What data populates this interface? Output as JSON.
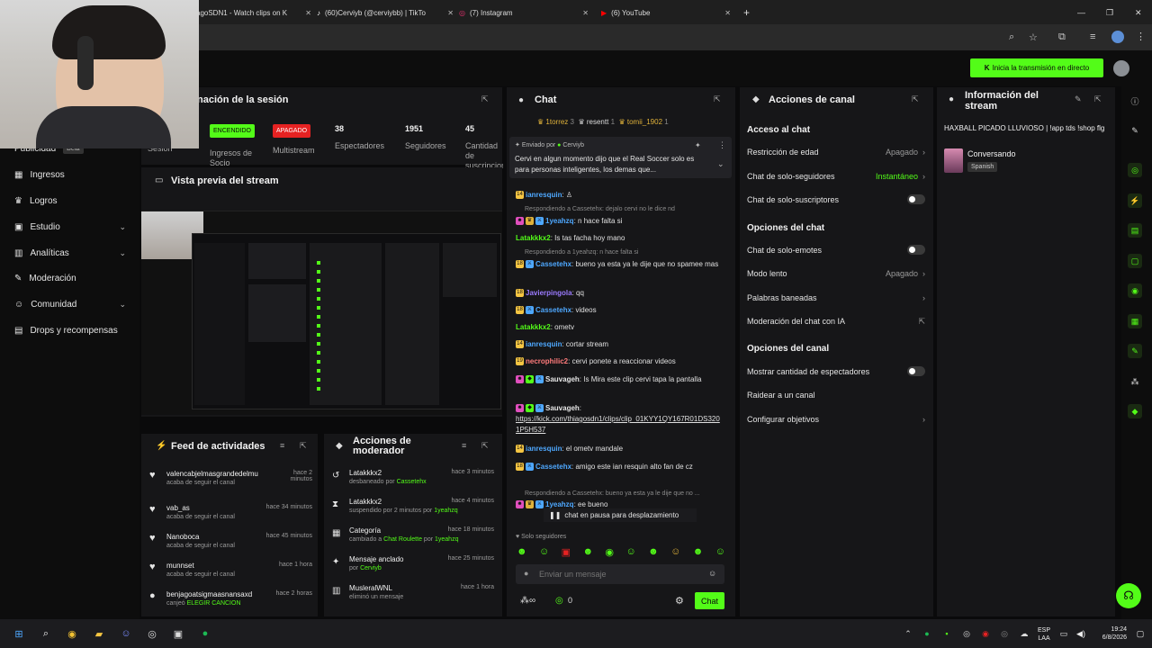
{
  "browser": {
    "tabs": [
      {
        "label": "agoSDN1 - Watch clips on K",
        "icon": "kick-icon"
      },
      {
        "label": "(60)Cerviyb (@cerviybb) | TikTo",
        "icon": "tiktok-icon"
      },
      {
        "label": "(7) Instagram",
        "icon": "instagram-icon"
      },
      {
        "label": "(6) YouTube",
        "icon": "youtube-icon"
      }
    ],
    "new_tab": "+",
    "window_controls": [
      "—",
      "❐",
      "✕"
    ]
  },
  "header": {
    "go_live_label": "Inicia la transmisión en directo"
  },
  "nav": {
    "items": [
      {
        "label": "Publicidad",
        "badge": "Beta"
      },
      {
        "label": "Ingresos"
      },
      {
        "label": "Logros"
      },
      {
        "label": "Estudio",
        "expand": true
      },
      {
        "label": "Analíticas",
        "expand": true
      },
      {
        "label": "Moderación"
      },
      {
        "label": "Comunidad",
        "expand": true
      },
      {
        "label": "Drops y recompensas"
      }
    ]
  },
  "session": {
    "title": "nación de la sesión",
    "stats": [
      {
        "label_bottom": "Sesión"
      },
      {
        "value": "ENCENDIDO",
        "label": "Ingresos de Socio",
        "color": "#53fc18"
      },
      {
        "value": "APAGADO",
        "label": "Multistream",
        "color": "#e62222"
      },
      {
        "value": "38",
        "label": "Espectadores"
      },
      {
        "value": "1951",
        "label": "Seguidores"
      },
      {
        "value": "45",
        "label": "Cantidad de suscripcion"
      }
    ]
  },
  "preview": {
    "title": "Vista previa del stream"
  },
  "feed": {
    "title": "Feed de actividades",
    "rows": [
      {
        "name": "valencabjelmasgrandedelmu",
        "sub": "acaba de seguir el canal",
        "time": "hace 2 minutos"
      },
      {
        "name": "vab_as",
        "sub": "acaba de seguir el canal",
        "time": "hace 34 minutos"
      },
      {
        "name": "Nanoboca",
        "sub": "acaba de seguir el canal",
        "time": "hace 45 minutos"
      },
      {
        "name": "munnset",
        "sub": "acaba de seguir el canal",
        "time": "hace 1 hora"
      },
      {
        "name": "benjagoatsigmaasnansaxd",
        "sub": "canjeó",
        "highlight": "ELEGIR CANCION",
        "time": "hace 2 horas"
      }
    ]
  },
  "modactions": {
    "title": "Acciones de moderador",
    "rows": [
      {
        "name": "Latakkkx2",
        "sub": "desbaneado por",
        "by": "Cassetehx",
        "time": "hace 3 minutos"
      },
      {
        "name": "Latakkkx2",
        "sub": "suspendido por 2 minutos por",
        "by": "1yeahzq",
        "time": "hace 4 minutos"
      },
      {
        "name": "Categoría",
        "sub": "cambiado a",
        "target": "Chat Roulette",
        "sub2": "por",
        "by": "1yeahzq",
        "time": "hace 18 minutos"
      },
      {
        "name": "Mensaje anclado",
        "sub": "por",
        "by": "Cerviyb",
        "time": "hace 25 minutos"
      },
      {
        "name": "MusleralWNL",
        "sub": "eliminó un mensaje",
        "time": "hace 1 hora"
      }
    ]
  },
  "chat": {
    "title": "Chat",
    "leaders": [
      {
        "name": "1torrez",
        "count": "3"
      },
      {
        "name": "resentt",
        "count": "1"
      },
      {
        "name": "tomii_1902",
        "count": "1"
      }
    ],
    "pinned": {
      "label": "Enviado por",
      "by": "Cerviyb",
      "text": "Cervi en algun momento dijo que el Real Soccer solo es para personas inteligentes, los demas que..."
    },
    "messages": [
      {
        "user": "ianresquin",
        "text": "",
        "color": "#4ea8ff",
        "badge": "18"
      },
      {
        "reply": "Respondiendo a Cassetehx: dejalo cervi no le dice nd"
      },
      {
        "user": "1yeahzq",
        "text": "n hace falta si",
        "color": "#4ea8ff",
        "badge": "mod"
      },
      {
        "user": "Latakkkx2",
        "text": "Is tas facha hoy mano",
        "color": "#53fc18"
      },
      {
        "reply": "Respondiendo a 1yeahzq: n hace falta si"
      },
      {
        "user": "Cassetehx",
        "text": "bueno ya esta ya le dije que no spamee mas",
        "color": "#4ea8ff",
        "badge": "18"
      },
      {
        "user": "Javierpingola",
        "text": "qq",
        "color": "#9b7bff",
        "badge": "18"
      },
      {
        "user": "Cassetehx",
        "text": "videos",
        "color": "#4ea8ff",
        "badge": "18"
      },
      {
        "user": "Latakkkx2",
        "text": "ometv",
        "color": "#53fc18"
      },
      {
        "user": "ianresquin",
        "text": "cortar stream",
        "color": "#4ea8ff",
        "badge": "14"
      },
      {
        "user": "necrophilic2",
        "text": "cervi ponete a reaccionar videos",
        "color": "#ff7b7b",
        "badge": "19"
      },
      {
        "user": "Sauvageh",
        "text": "Is Mira este clip cervi tapa la pantalla",
        "color": "#e6e6e6",
        "badge": "mod"
      },
      {
        "user": "Sauvageh",
        "text": "https://kick.com/thiagosdn1/clips/clip_01KYY1QY167R01DS3201P5H537",
        "color": "#e6e6e6",
        "badge": "mod"
      },
      {
        "user": "ianresquin",
        "text": "el ometv mandale",
        "color": "#4ea8ff",
        "badge": "14"
      },
      {
        "user": "Cassetehx",
        "text": "amigo este ian resquin alto fan de cz",
        "color": "#4ea8ff",
        "badge": "18"
      },
      {
        "reply": "Respondiendo a Cassetehx: bueno ya esta ya le dije que no ..."
      },
      {
        "user": "1yeahzq",
        "text": "ee bueno",
        "color": "#4ea8ff",
        "badge": "mod"
      }
    ],
    "paused": "chat en pausa para desplazamiento",
    "followers_only": "Solo seguidores",
    "input_placeholder": "Enviar un mensaje",
    "points": "0",
    "send_label": "Chat"
  },
  "channel_actions": {
    "title": "Acciones de canal",
    "sections": [
      {
        "title": "Acceso al chat",
        "rows": [
          {
            "label": "Restricción de edad",
            "value": "Apagado",
            "kind": "arrow"
          },
          {
            "label": "Chat de solo-seguidores",
            "value": "Instantáneo",
            "kind": "arrow",
            "value_color": "#53fc18"
          },
          {
            "label": "Chat de solo-suscriptores",
            "kind": "toggle"
          }
        ]
      },
      {
        "title": "Opciones del chat",
        "rows": [
          {
            "label": "Chat de solo-emotes",
            "kind": "toggle"
          },
          {
            "label": "Modo lento",
            "value": "Apagado",
            "kind": "arrow"
          },
          {
            "label": "Palabras baneadas",
            "kind": "arrow"
          },
          {
            "label": "Moderación del chat con IA",
            "kind": "ext"
          }
        ]
      },
      {
        "title": "Opciones del canal",
        "rows": [
          {
            "label": "Mostrar cantidad de espectadores",
            "kind": "toggle"
          },
          {
            "label": "Raidear a un canal",
            "kind": "none"
          },
          {
            "label": "Configurar objetivos",
            "kind": "arrow"
          }
        ]
      }
    ]
  },
  "stream_info": {
    "title": "Información del stream",
    "stream_title": "HAXBALL PICADO LLUVIOSO | !app tds !shop flg",
    "category": "Conversando",
    "language": "Spanish"
  },
  "taskbar": {
    "lang": "ESP",
    "lang2": "LAA",
    "time": "19:24",
    "date": "6/8/2026"
  }
}
